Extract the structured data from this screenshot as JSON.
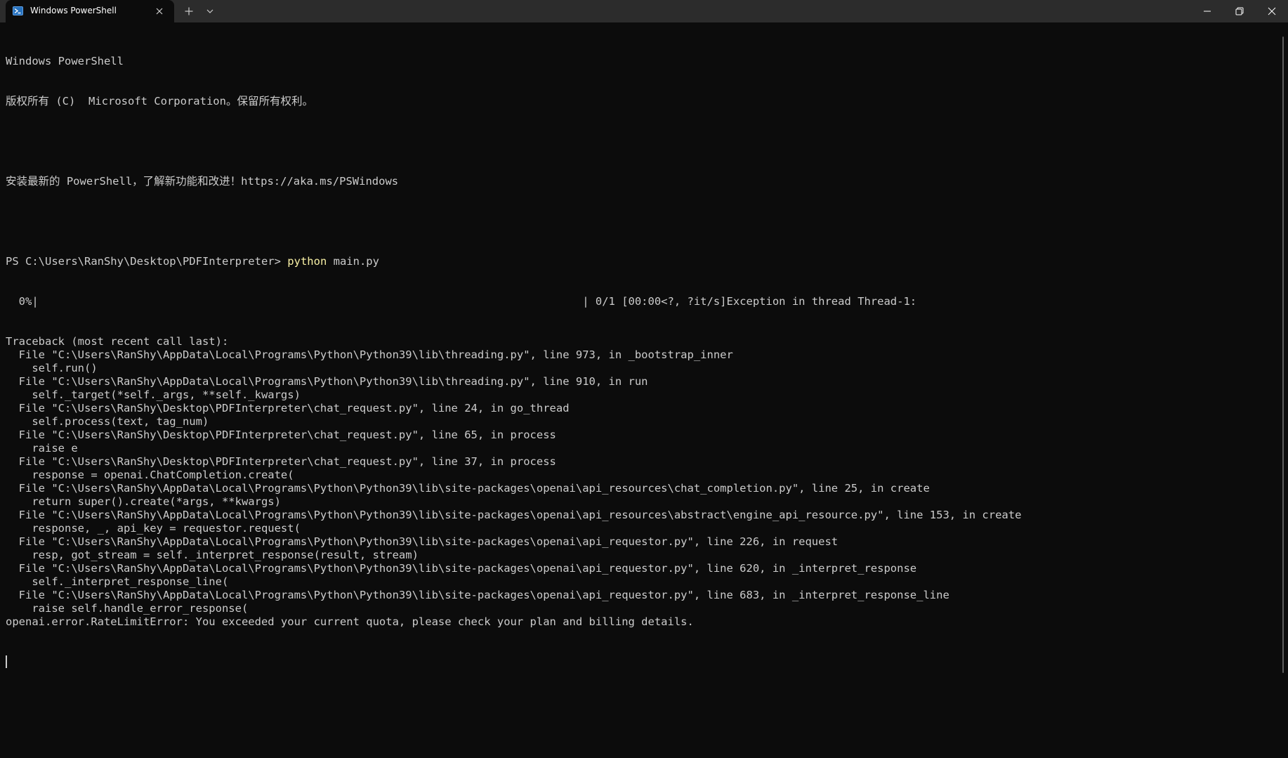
{
  "titlebar": {
    "tab_title": "Windows PowerShell",
    "tab_icon": "powershell-icon",
    "new_tab_icon": "plus-icon",
    "dropdown_icon": "chevron-down-icon",
    "window_controls": [
      "minimize-icon",
      "maximize-icon",
      "close-icon"
    ]
  },
  "terminal": {
    "header": {
      "line1": "Windows PowerShell",
      "line2": "版权所有 (C)  Microsoft Corporation。保留所有权利。",
      "line3": "",
      "line4": "安装最新的 PowerShell，了解新功能和改进！https://aka.ms/PSWindows",
      "line5": ""
    },
    "prompt": {
      "path": "PS C:\\Users\\RanShy\\Desktop\\PDFInterpreter> ",
      "command": "python",
      "args": " main.py"
    },
    "progress_line": "  0%|                                                                                   | 0/1 [00:00<?, ?it/s]Exception in thread Thread-1:",
    "traceback": [
      "Traceback (most recent call last):",
      "  File \"C:\\Users\\RanShy\\AppData\\Local\\Programs\\Python\\Python39\\lib\\threading.py\", line 973, in _bootstrap_inner",
      "    self.run()",
      "  File \"C:\\Users\\RanShy\\AppData\\Local\\Programs\\Python\\Python39\\lib\\threading.py\", line 910, in run",
      "    self._target(*self._args, **self._kwargs)",
      "  File \"C:\\Users\\RanShy\\Desktop\\PDFInterpreter\\chat_request.py\", line 24, in go_thread",
      "    self.process(text, tag_num)",
      "  File \"C:\\Users\\RanShy\\Desktop\\PDFInterpreter\\chat_request.py\", line 65, in process",
      "    raise e",
      "  File \"C:\\Users\\RanShy\\Desktop\\PDFInterpreter\\chat_request.py\", line 37, in process",
      "    response = openai.ChatCompletion.create(",
      "  File \"C:\\Users\\RanShy\\AppData\\Local\\Programs\\Python\\Python39\\lib\\site-packages\\openai\\api_resources\\chat_completion.py\", line 25, in create",
      "    return super().create(*args, **kwargs)",
      "  File \"C:\\Users\\RanShy\\AppData\\Local\\Programs\\Python\\Python39\\lib\\site-packages\\openai\\api_resources\\abstract\\engine_api_resource.py\", line 153, in create",
      "    response, _, api_key = requestor.request(",
      "  File \"C:\\Users\\RanShy\\AppData\\Local\\Programs\\Python\\Python39\\lib\\site-packages\\openai\\api_requestor.py\", line 226, in request",
      "    resp, got_stream = self._interpret_response(result, stream)",
      "  File \"C:\\Users\\RanShy\\AppData\\Local\\Programs\\Python\\Python39\\lib\\site-packages\\openai\\api_requestor.py\", line 620, in _interpret_response",
      "    self._interpret_response_line(",
      "  File \"C:\\Users\\RanShy\\AppData\\Local\\Programs\\Python\\Python39\\lib\\site-packages\\openai\\api_requestor.py\", line 683, in _interpret_response_line",
      "    raise self.handle_error_response(",
      "openai.error.RateLimitError: You exceeded your current quota, please check your plan and billing details."
    ]
  },
  "colors": {
    "background": "#0c0c0c",
    "titlebar": "#2c2c2c",
    "text": "#cccccc",
    "command_highlight": "#f9f1a5"
  }
}
